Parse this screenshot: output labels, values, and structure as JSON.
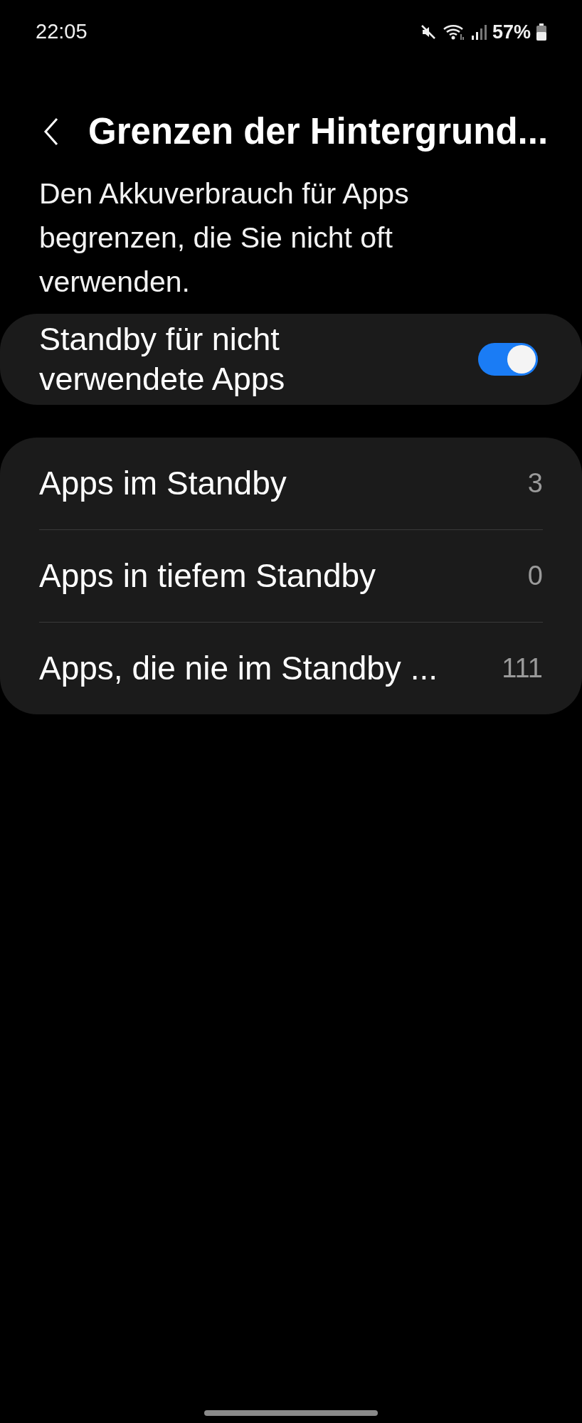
{
  "status_bar": {
    "time": "22:05",
    "battery": "57%"
  },
  "header": {
    "title": "Grenzen der Hintergrund..."
  },
  "description": "Den Akkuverbrauch für Apps begrenzen, die Sie nicht oft verwenden.",
  "standby_switch": {
    "label": "Standby für nicht verwendete Apps",
    "on": true
  },
  "items": [
    {
      "label": "Apps im Standby",
      "count": "3"
    },
    {
      "label": "Apps in tiefem Standby",
      "count": "0"
    },
    {
      "label": "Apps, die nie im Standby ...",
      "count": "111"
    }
  ]
}
